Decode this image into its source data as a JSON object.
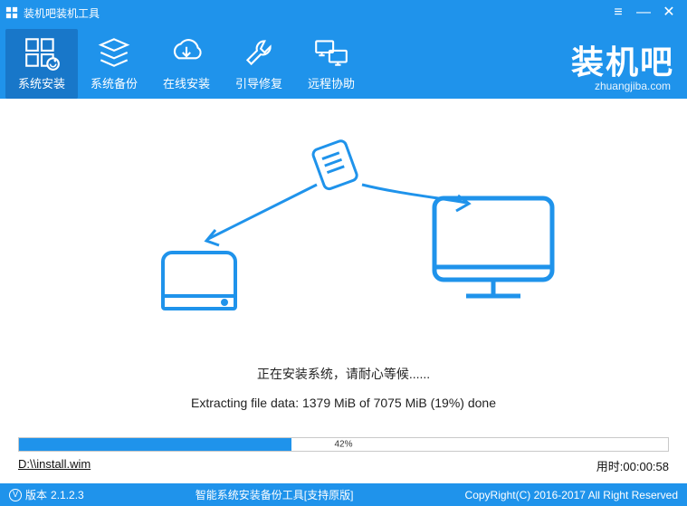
{
  "window": {
    "title": "装机吧装机工具"
  },
  "tabs": [
    {
      "label": "系统安装"
    },
    {
      "label": "系统备份"
    },
    {
      "label": "在线安装"
    },
    {
      "label": "引导修复"
    },
    {
      "label": "远程协助"
    }
  ],
  "brand": {
    "name": "装机吧",
    "url": "zhuangjiba.com"
  },
  "status_text": "正在安装系统，请耐心等候......",
  "extract_text": "Extracting file data: 1379 MiB of 7075 MiB (19%) done",
  "progress": {
    "percent": 42,
    "label": "42%"
  },
  "file_path": "D:\\\\install.wim",
  "elapsed_label": "用时:",
  "elapsed_value": "00:00:58",
  "footer": {
    "version_label": "版本",
    "version_value": "2.1.2.3",
    "mid_text": "智能系统安装备份工具[支持原版]",
    "copyright": "CopyRight(C) 2016-2017 All Right Reserved"
  }
}
